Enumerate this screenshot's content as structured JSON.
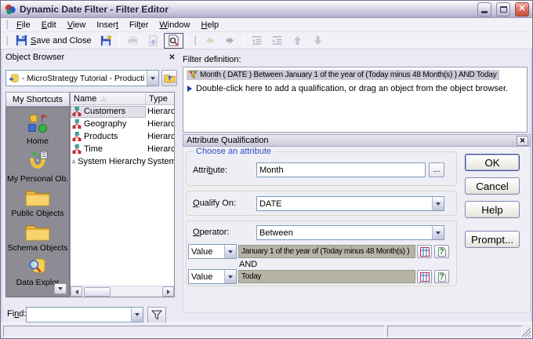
{
  "window": {
    "title": "Dynamic Date Filter - Filter Editor"
  },
  "icons": {
    "close_glyph": "✕",
    "sort_ascending_glyph": "△",
    "prompt_glyph": "?"
  },
  "menu": {
    "items": [
      {
        "pre": "",
        "key": "F",
        "post": "ile"
      },
      {
        "pre": "",
        "key": "E",
        "post": "dit"
      },
      {
        "pre": "",
        "key": "V",
        "post": "iew"
      },
      {
        "pre": "Inser",
        "key": "t",
        "post": ""
      },
      {
        "pre": "Fil",
        "key": "t",
        "post": "er"
      },
      {
        "pre": "",
        "key": "W",
        "post": "indow"
      },
      {
        "pre": "",
        "key": "H",
        "post": "elp"
      }
    ]
  },
  "toolbar": {
    "save_and_close": {
      "pre": "",
      "key": "S",
      "post": "ave and Close"
    }
  },
  "object_browser": {
    "title": "Object Browser",
    "project": "- MicroStrategy Tutorial - Production",
    "shortcuts_title": "My Shortcuts",
    "shortcuts": [
      {
        "label": "Home"
      },
      {
        "label": "My Personal Ob..."
      },
      {
        "label": "Public Objects"
      },
      {
        "label": "Schema Objects"
      },
      {
        "label": "Data Explor"
      }
    ],
    "columns": {
      "name": "Name",
      "type": "Type"
    },
    "rows": [
      {
        "name": "Customers",
        "type": "Hierarchy"
      },
      {
        "name": "Geography",
        "type": "Hierarchy"
      },
      {
        "name": "Products",
        "type": "Hierarchy"
      },
      {
        "name": "Time",
        "type": "Hierarchy"
      },
      {
        "name": "System Hierarchy",
        "type": "System Hierarchy"
      }
    ],
    "find_label": {
      "pre": "Fi",
      "key": "n",
      "post": "d:"
    },
    "find_value": ""
  },
  "filter_definition": {
    "label": "Filter definition:",
    "qualification": "Month ( DATE )  Between January 1 of the year of (Today minus 48 Month(s) ) AND Today",
    "hint": "Double-click here to add a qualification, or drag an object from the object browser."
  },
  "attribute_qualification": {
    "title": "Attribute Qualification",
    "group_caption": "Choose an attribute",
    "attribute_label": {
      "pre": "Attri",
      "key": "b",
      "post": "ute:"
    },
    "attribute_value": "Month",
    "browse_label": "...",
    "qualify_label": {
      "pre": "",
      "key": "Q",
      "post": "ualify On:"
    },
    "qualify_value": "DATE",
    "operator_label": {
      "pre": "",
      "key": "O",
      "post": "perator:"
    },
    "operator_value": "Between",
    "connector": "AND",
    "value_rows": [
      {
        "selector": "Value",
        "expression": "January 1 of the year of (Today minus 48 Month(s) )"
      },
      {
        "selector": "Value",
        "expression": "Today"
      }
    ]
  },
  "action_buttons": {
    "ok": "OK",
    "cancel": "Cancel",
    "help": "Help",
    "prompt": "Prompt..."
  },
  "colors": {
    "readonly_field_bg": "#b5b4a6",
    "selection_bg": "#cac9d5",
    "group_caption_blue": "#2e4fc4",
    "shortcuts_panel_bg": "#8d8c94",
    "close_button_red": "#dd6f5c"
  }
}
